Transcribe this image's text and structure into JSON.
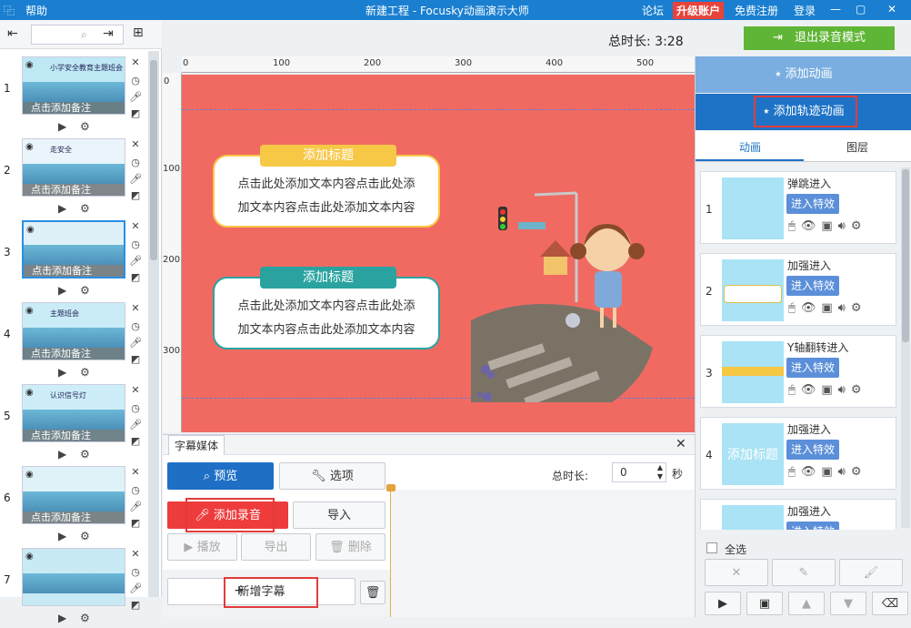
{
  "titlebar": {
    "icon": "help-icon",
    "help": "帮助",
    "title": "新建工程 - Focusky动画演示大师",
    "forum": "论坛",
    "upgrade": "升级账户",
    "register": "免费注册",
    "login": "登录"
  },
  "header": {
    "total_time_label": "总时长: 3:28",
    "exit_button": "退出录音模式"
  },
  "slides": [
    {
      "num": "1",
      "note": "点击添加备注",
      "title_in_thumb": "小学安全教育主题班会"
    },
    {
      "num": "2",
      "note": "点击添加备注",
      "title_in_thumb": "走安全"
    },
    {
      "num": "3",
      "note": "点击添加备注"
    },
    {
      "num": "4",
      "note": "点击添加备注",
      "title_in_thumb": "主题班会"
    },
    {
      "num": "5",
      "note": "点击添加备注",
      "title_in_thumb": "认识信号灯"
    },
    {
      "num": "6",
      "note": "点击添加备注"
    },
    {
      "num": "7",
      "note": ""
    }
  ],
  "ruler": {
    "top": [
      "0",
      "100",
      "200",
      "300",
      "400",
      "500"
    ],
    "left": [
      "0",
      "100",
      "200",
      "300"
    ]
  },
  "canvas": {
    "card1": {
      "tag": "添加标题",
      "line1": "点击此处添加文本内容点击此处添",
      "line2": "加文本内容点击此处添加文本内容"
    },
    "card2": {
      "tag": "添加标题",
      "line1": "点击此处添加文本内容点击此处添",
      "line2": "加文本内容点击此处添加文本内容"
    }
  },
  "right": {
    "add_anim": "添加动画",
    "add_path_anim": "添加轨迹动画",
    "tab_anim": "动画",
    "tab_layer": "图层",
    "items": [
      {
        "num": "1",
        "name": "弹跳进入",
        "effect": "进入特效"
      },
      {
        "num": "2",
        "name": "加强进入",
        "effect": "进入特效"
      },
      {
        "num": "3",
        "name": "Y轴翻转进入",
        "effect": "进入特效"
      },
      {
        "num": "4",
        "name": "加强进入",
        "effect": "进入特效",
        "thumb_text": "添加标题"
      },
      {
        "num": "",
        "name": "加强进入",
        "effect": "进入特效"
      }
    ],
    "select_all": "全选"
  },
  "bottom": {
    "tab": "字幕媒体",
    "total_label": "总时长:",
    "total_value": "0",
    "sec": "秒",
    "preview": "预览",
    "options": "选项",
    "add_record": "添加录音",
    "import": "导入",
    "play": "播放",
    "export": "导出",
    "delete": "删除",
    "new_subtitle": "新增字幕"
  },
  "colors": {
    "accent": "#1a7fd0",
    "canvas_bg": "#f06a62",
    "green": "#5fb535",
    "red": "#e8433a"
  }
}
